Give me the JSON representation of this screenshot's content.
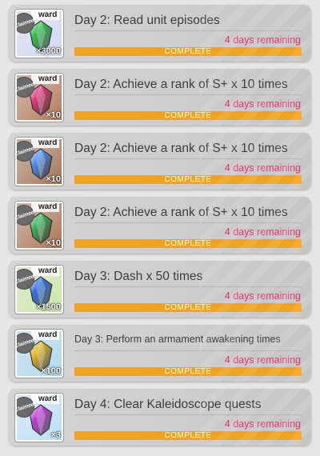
{
  "missions": [
    {
      "title": "Day 2: Read  unit episodes",
      "title_small": false,
      "remaining": "4 days remaining",
      "status": "COMPLETE",
      "progress": 1.0,
      "reward_tag": "ward",
      "claimed": "Claimed",
      "quantity": "×3000",
      "reward_icon": "green-crystal-icon",
      "bg": "#cfd6f4",
      "gem": "#2fbf4a"
    },
    {
      "title": "Day 2: Achieve a rank of S+  x 10 times",
      "title_small": false,
      "remaining": "4 days remaining",
      "status": "COMPLETE",
      "progress": 1.0,
      "reward_tag": "ward",
      "claimed": "Claimed",
      "quantity": "×10",
      "reward_icon": "red-gem-icon",
      "bg": "#b07050",
      "gem": "#e0367a"
    },
    {
      "title": "Day 2: Achieve a rank of S+  x 10 times",
      "title_small": false,
      "remaining": "4 days remaining",
      "status": "COMPLETE",
      "progress": 1.0,
      "reward_tag": "ward",
      "claimed": "Claimed",
      "quantity": "×10",
      "reward_icon": "blue-gem-icon",
      "bg": "#a06a4a",
      "gem": "#4a8ef0"
    },
    {
      "title": "Day 2: Achieve a rank of S+  x 10 times",
      "title_small": false,
      "remaining": "4 days remaining",
      "status": "COMPLETE",
      "progress": 1.0,
      "reward_tag": "ward",
      "claimed": "Claimed",
      "quantity": "×10",
      "reward_icon": "green-gem-icon",
      "bg": "#a86a48",
      "gem": "#37b35a"
    },
    {
      "title": "Day 3: Dash  x 50 times",
      "title_small": false,
      "remaining": "4 days remaining",
      "status": "COMPLETE",
      "progress": 1.0,
      "reward_tag": "ward",
      "claimed": "Claimed",
      "quantity": "×1500",
      "reward_icon": "blue-flame-crystal-icon",
      "bg": "#c8e6a0",
      "gem": "#2f6fe0"
    },
    {
      "title": "Day 3: Perform an armament awakening  times",
      "title_small": true,
      "remaining": "4 days remaining",
      "status": "COMPLETE",
      "progress": 1.0,
      "reward_tag": "ward",
      "claimed": "Claimed",
      "quantity": "×100",
      "reward_icon": "gold-potion-icon",
      "bg": "#a8d8f0",
      "gem": "#e2b421"
    },
    {
      "title": "Day 4: Clear  Kaleidoscope quests",
      "title_small": false,
      "remaining": "4 days remaining",
      "status": "COMPLETE",
      "progress": 1.0,
      "reward_tag": "ward",
      "claimed": "Claimed",
      "quantity": "×3",
      "reward_icon": "purple-crystal-icon",
      "bg": "#b8e0f8",
      "gem": "#c43bd8"
    }
  ]
}
